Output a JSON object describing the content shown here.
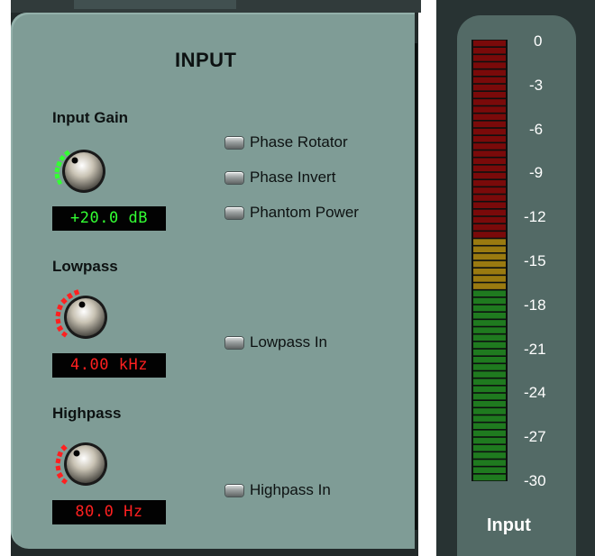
{
  "panel": {
    "title": "INPUT",
    "input_gain": {
      "label": "Input Gain",
      "readout": "+20.0 dB"
    },
    "lowpass": {
      "label": "Lowpass",
      "readout": "4.00 kHz"
    },
    "highpass": {
      "label": "Highpass",
      "readout": "80.0 Hz"
    },
    "toggles": {
      "phase_rotator": "Phase Rotator",
      "phase_invert": "Phase Invert",
      "phantom_power": "Phantom Power",
      "lowpass_in": "Lowpass In",
      "highpass_in": "Highpass In"
    }
  },
  "meter": {
    "caption": "Input",
    "scale": [
      "0",
      "-3",
      "-6",
      "-9",
      "-12",
      "-15",
      "-18",
      "-21",
      "-24",
      "-27",
      "-30"
    ],
    "colors": {
      "red": "#7a0a0a",
      "amber": "#9a7a10",
      "green": "#1f7a1f"
    }
  },
  "colors": {
    "panel": "#7f9c96",
    "gain_arc": "#33ff33",
    "filter_arc": "#ff2020",
    "meter_panel": "#536a66"
  }
}
